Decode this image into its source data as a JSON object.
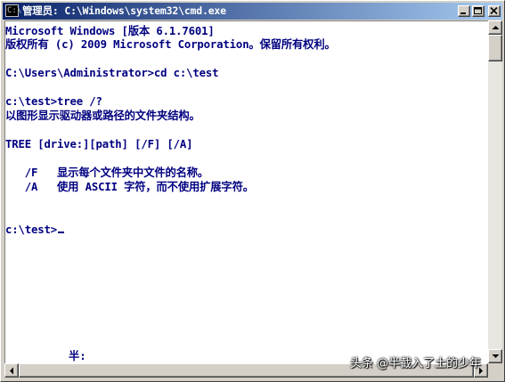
{
  "window": {
    "title": "管理员: C:\\Windows\\system32\\cmd.exe",
    "icon": "cmd-console-icon",
    "controls": [
      "minimize-icon",
      "maximize-icon",
      "close-icon"
    ]
  },
  "console": {
    "lines": [
      "Microsoft Windows [版本 6.1.7601]",
      "版权所有 (c) 2009 Microsoft Corporation。保留所有权利。",
      "",
      "C:\\Users\\Administrator>cd c:\\test",
      "",
      "c:\\test>tree /?",
      "以图形显示驱动器或路径的文件夹结构。",
      "",
      "TREE [drive:][path] [/F] [/A]",
      "",
      "   /F   显示每个文件夹中文件的名称。",
      "   /A   使用 ASCII 字符，而不使用扩展字符。",
      "",
      "",
      "c:\\test>"
    ],
    "ime_status": "半:"
  },
  "watermark": "头条 @半截入了土的少年",
  "colors": {
    "console_text": "#000080",
    "console_background": "#ffffff",
    "title_gradient_start": "#0a246a",
    "title_gradient_end": "#a6caf0"
  }
}
